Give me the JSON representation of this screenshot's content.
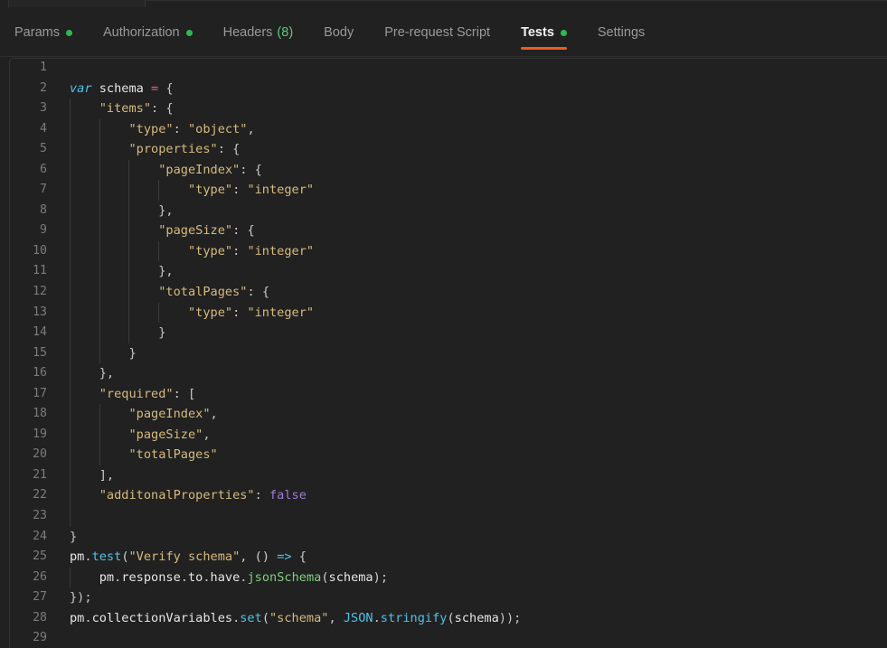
{
  "window": {
    "background_color": "#212121",
    "accent_color": "#ef5b25",
    "dot_color": "#30b850"
  },
  "tabstrip": {
    "open_tab_label": ""
  },
  "section_tabs": [
    {
      "label": "Params",
      "dot": true,
      "count": null,
      "active": false
    },
    {
      "label": "Authorization",
      "dot": true,
      "count": null,
      "active": false
    },
    {
      "label": "Headers",
      "dot": false,
      "count": "(8)",
      "active": false
    },
    {
      "label": "Body",
      "dot": false,
      "count": null,
      "active": false
    },
    {
      "label": "Pre-request Script",
      "dot": false,
      "count": null,
      "active": false
    },
    {
      "label": "Tests",
      "dot": true,
      "count": null,
      "active": true
    },
    {
      "label": "Settings",
      "dot": false,
      "count": null,
      "active": false
    }
  ],
  "editor": {
    "language": "javascript",
    "first_line": 1,
    "last_line": 29,
    "lines": [
      {
        "n": 1,
        "guides": 0,
        "tokens": []
      },
      {
        "n": 2,
        "guides": 0,
        "tokens": [
          {
            "t": "var ",
            "c": "t-kw"
          },
          {
            "t": "schema ",
            "c": "t-plain"
          },
          {
            "t": "=",
            "c": "t-op"
          },
          {
            "t": " ",
            "c": "t-plain"
          },
          {
            "t": "{",
            "c": "t-pun"
          }
        ]
      },
      {
        "n": 3,
        "guides": 1,
        "tokens": [
          {
            "t": "    ",
            "c": "t-plain"
          },
          {
            "t": "\"items\"",
            "c": "t-str"
          },
          {
            "t": ": ",
            "c": "t-pun"
          },
          {
            "t": "{",
            "c": "t-pun"
          }
        ]
      },
      {
        "n": 4,
        "guides": 2,
        "tokens": [
          {
            "t": "        ",
            "c": "t-plain"
          },
          {
            "t": "\"type\"",
            "c": "t-str"
          },
          {
            "t": ": ",
            "c": "t-pun"
          },
          {
            "t": "\"object\"",
            "c": "t-str"
          },
          {
            "t": ",",
            "c": "t-pun"
          }
        ]
      },
      {
        "n": 5,
        "guides": 2,
        "tokens": [
          {
            "t": "        ",
            "c": "t-plain"
          },
          {
            "t": "\"properties\"",
            "c": "t-str"
          },
          {
            "t": ": ",
            "c": "t-pun"
          },
          {
            "t": "{",
            "c": "t-pun"
          }
        ]
      },
      {
        "n": 6,
        "guides": 3,
        "tokens": [
          {
            "t": "            ",
            "c": "t-plain"
          },
          {
            "t": "\"pageIndex\"",
            "c": "t-str"
          },
          {
            "t": ": ",
            "c": "t-pun"
          },
          {
            "t": "{",
            "c": "t-pun"
          }
        ]
      },
      {
        "n": 7,
        "guides": 4,
        "tokens": [
          {
            "t": "                ",
            "c": "t-plain"
          },
          {
            "t": "\"type\"",
            "c": "t-str"
          },
          {
            "t": ": ",
            "c": "t-pun"
          },
          {
            "t": "\"integer\"",
            "c": "t-str"
          }
        ]
      },
      {
        "n": 8,
        "guides": 3,
        "tokens": [
          {
            "t": "            ",
            "c": "t-plain"
          },
          {
            "t": "},",
            "c": "t-pun"
          }
        ]
      },
      {
        "n": 9,
        "guides": 3,
        "tokens": [
          {
            "t": "            ",
            "c": "t-plain"
          },
          {
            "t": "\"pageSize\"",
            "c": "t-str"
          },
          {
            "t": ": ",
            "c": "t-pun"
          },
          {
            "t": "{",
            "c": "t-pun"
          }
        ]
      },
      {
        "n": 10,
        "guides": 4,
        "tokens": [
          {
            "t": "                ",
            "c": "t-plain"
          },
          {
            "t": "\"type\"",
            "c": "t-str"
          },
          {
            "t": ": ",
            "c": "t-pun"
          },
          {
            "t": "\"integer\"",
            "c": "t-str"
          }
        ]
      },
      {
        "n": 11,
        "guides": 3,
        "tokens": [
          {
            "t": "            ",
            "c": "t-plain"
          },
          {
            "t": "},",
            "c": "t-pun"
          }
        ]
      },
      {
        "n": 12,
        "guides": 3,
        "tokens": [
          {
            "t": "            ",
            "c": "t-plain"
          },
          {
            "t": "\"totalPages\"",
            "c": "t-str"
          },
          {
            "t": ": ",
            "c": "t-pun"
          },
          {
            "t": "{",
            "c": "t-pun"
          }
        ]
      },
      {
        "n": 13,
        "guides": 4,
        "tokens": [
          {
            "t": "                ",
            "c": "t-plain"
          },
          {
            "t": "\"type\"",
            "c": "t-str"
          },
          {
            "t": ": ",
            "c": "t-pun"
          },
          {
            "t": "\"integer\"",
            "c": "t-str"
          }
        ]
      },
      {
        "n": 14,
        "guides": 3,
        "tokens": [
          {
            "t": "            ",
            "c": "t-plain"
          },
          {
            "t": "}",
            "c": "t-pun"
          }
        ]
      },
      {
        "n": 15,
        "guides": 2,
        "tokens": [
          {
            "t": "        ",
            "c": "t-plain"
          },
          {
            "t": "}",
            "c": "t-pun"
          }
        ]
      },
      {
        "n": 16,
        "guides": 1,
        "tokens": [
          {
            "t": "    ",
            "c": "t-plain"
          },
          {
            "t": "},",
            "c": "t-pun"
          }
        ]
      },
      {
        "n": 17,
        "guides": 1,
        "tokens": [
          {
            "t": "    ",
            "c": "t-plain"
          },
          {
            "t": "\"required\"",
            "c": "t-str"
          },
          {
            "t": ": ",
            "c": "t-pun"
          },
          {
            "t": "[",
            "c": "t-pun"
          }
        ]
      },
      {
        "n": 18,
        "guides": 2,
        "tokens": [
          {
            "t": "        ",
            "c": "t-plain"
          },
          {
            "t": "\"pageIndex\"",
            "c": "t-str"
          },
          {
            "t": ",",
            "c": "t-pun"
          }
        ]
      },
      {
        "n": 19,
        "guides": 2,
        "tokens": [
          {
            "t": "        ",
            "c": "t-plain"
          },
          {
            "t": "\"pageSize\"",
            "c": "t-str"
          },
          {
            "t": ",",
            "c": "t-pun"
          }
        ]
      },
      {
        "n": 20,
        "guides": 2,
        "tokens": [
          {
            "t": "        ",
            "c": "t-plain"
          },
          {
            "t": "\"totalPages\"",
            "c": "t-str"
          }
        ]
      },
      {
        "n": 21,
        "guides": 1,
        "tokens": [
          {
            "t": "    ",
            "c": "t-plain"
          },
          {
            "t": "],",
            "c": "t-pun"
          }
        ]
      },
      {
        "n": 22,
        "guides": 1,
        "tokens": [
          {
            "t": "    ",
            "c": "t-plain"
          },
          {
            "t": "\"additonalProperties\"",
            "c": "t-str"
          },
          {
            "t": ": ",
            "c": "t-pun"
          },
          {
            "t": "false",
            "c": "t-bool"
          }
        ]
      },
      {
        "n": 23,
        "guides": 1,
        "tokens": []
      },
      {
        "n": 24,
        "guides": 0,
        "tokens": [
          {
            "t": "}",
            "c": "t-pun"
          }
        ]
      },
      {
        "n": 25,
        "guides": 0,
        "tokens": [
          {
            "t": "pm",
            "c": "t-plain"
          },
          {
            "t": ".",
            "c": "t-pun"
          },
          {
            "t": "test",
            "c": "t-fn"
          },
          {
            "t": "(",
            "c": "t-paren"
          },
          {
            "t": "\"Verify schema\"",
            "c": "t-str"
          },
          {
            "t": ", ",
            "c": "t-pun"
          },
          {
            "t": "()",
            "c": "t-paren"
          },
          {
            "t": " ",
            "c": "t-plain"
          },
          {
            "t": "=>",
            "c": "t-arrow"
          },
          {
            "t": " ",
            "c": "t-plain"
          },
          {
            "t": "{",
            "c": "t-pun"
          }
        ]
      },
      {
        "n": 26,
        "guides": 1,
        "tokens": [
          {
            "t": "    ",
            "c": "t-plain"
          },
          {
            "t": "pm",
            "c": "t-plain"
          },
          {
            "t": ".",
            "c": "t-pun"
          },
          {
            "t": "response",
            "c": "t-plain"
          },
          {
            "t": ".",
            "c": "t-pun"
          },
          {
            "t": "to",
            "c": "t-plain"
          },
          {
            "t": ".",
            "c": "t-pun"
          },
          {
            "t": "have",
            "c": "t-plain"
          },
          {
            "t": ".",
            "c": "t-pun"
          },
          {
            "t": "jsonSchema",
            "c": "t-meth"
          },
          {
            "t": "(",
            "c": "t-paren"
          },
          {
            "t": "schema",
            "c": "t-plain"
          },
          {
            "t": ")",
            "c": "t-paren"
          },
          {
            "t": ";",
            "c": "t-pun"
          }
        ]
      },
      {
        "n": 27,
        "guides": 0,
        "tokens": [
          {
            "t": "});",
            "c": "t-pun"
          }
        ]
      },
      {
        "n": 28,
        "guides": 0,
        "tokens": [
          {
            "t": "pm",
            "c": "t-plain"
          },
          {
            "t": ".",
            "c": "t-pun"
          },
          {
            "t": "collectionVariables",
            "c": "t-plain"
          },
          {
            "t": ".",
            "c": "t-pun"
          },
          {
            "t": "set",
            "c": "t-fn"
          },
          {
            "t": "(",
            "c": "t-paren"
          },
          {
            "t": "\"schema\"",
            "c": "t-str"
          },
          {
            "t": ", ",
            "c": "t-pun"
          },
          {
            "t": "JSON",
            "c": "t-obj"
          },
          {
            "t": ".",
            "c": "t-pun"
          },
          {
            "t": "stringify",
            "c": "t-fn"
          },
          {
            "t": "(",
            "c": "t-paren"
          },
          {
            "t": "schema",
            "c": "t-plain"
          },
          {
            "t": "));",
            "c": "t-pun"
          }
        ]
      },
      {
        "n": 29,
        "guides": 0,
        "tokens": []
      }
    ]
  }
}
